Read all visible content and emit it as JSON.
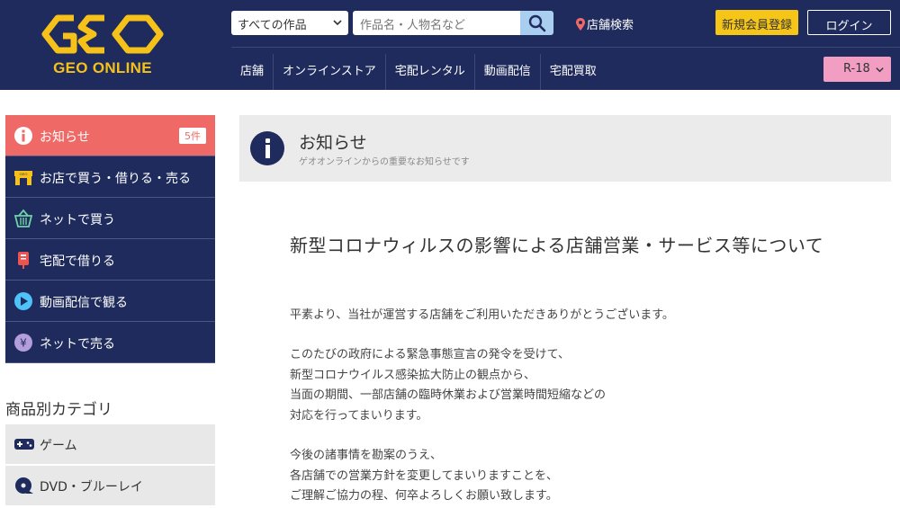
{
  "header": {
    "logo_text": "GEO ONLINE",
    "category_select": "すべての作品",
    "search_placeholder": "作品名・人物名など",
    "store_search": "店舗検索",
    "register": "新規会員登録",
    "login": "ログイン",
    "nav": [
      "店舗",
      "オンラインストア",
      "宅配レンタル",
      "動画配信",
      "宅配買取"
    ],
    "r18": "R-18"
  },
  "sidebar": {
    "items": [
      {
        "label": "お知らせ",
        "badge": "5件",
        "icon": "info-icon"
      },
      {
        "label": "お店で買う・借りる・売る",
        "icon": "store-icon"
      },
      {
        "label": "ネットで買う",
        "icon": "basket-icon"
      },
      {
        "label": "宅配で借りる",
        "icon": "mailbox-icon"
      },
      {
        "label": "動画配信で観る",
        "icon": "play-icon"
      },
      {
        "label": "ネットで売る",
        "icon": "yen-icon"
      }
    ],
    "category_title": "商品別カテゴリ",
    "categories": [
      {
        "label": "ゲーム",
        "icon": "gamepad-icon"
      },
      {
        "label": "DVD・ブルーレイ",
        "icon": "disc-icon"
      }
    ]
  },
  "main": {
    "section_title": "お知らせ",
    "section_subtitle": "ゲオオンラインからの重要なお知らせです",
    "article_title": "新型コロナウィルスの影響による店舗営業・サービス等について",
    "paragraphs": [
      [
        "平素より、当社が運営する店舗をご利用いただきありがとうございます。"
      ],
      [
        "このたびの政府による緊急事態宣言の発令を受けて、",
        "新型コロナウイルス感染拡大防止の観点から、",
        "当面の期間、一部店舗の臨時休業および営業時間短縮などの",
        "対応を行ってまいります。"
      ],
      [
        "今後の諸事情を勘案のうえ、",
        "各店舗での営業方針を変更してまいりますことを、",
        "ご理解ご協力の程、何卒よろしくお願い致します。"
      ]
    ]
  },
  "colors": {
    "navy": "#1e2b5c",
    "logo_yellow": "#f6c21a",
    "active_red": "#ef6a66",
    "r18_pink": "#f19ec2",
    "search_blue": "#a9cef0"
  }
}
